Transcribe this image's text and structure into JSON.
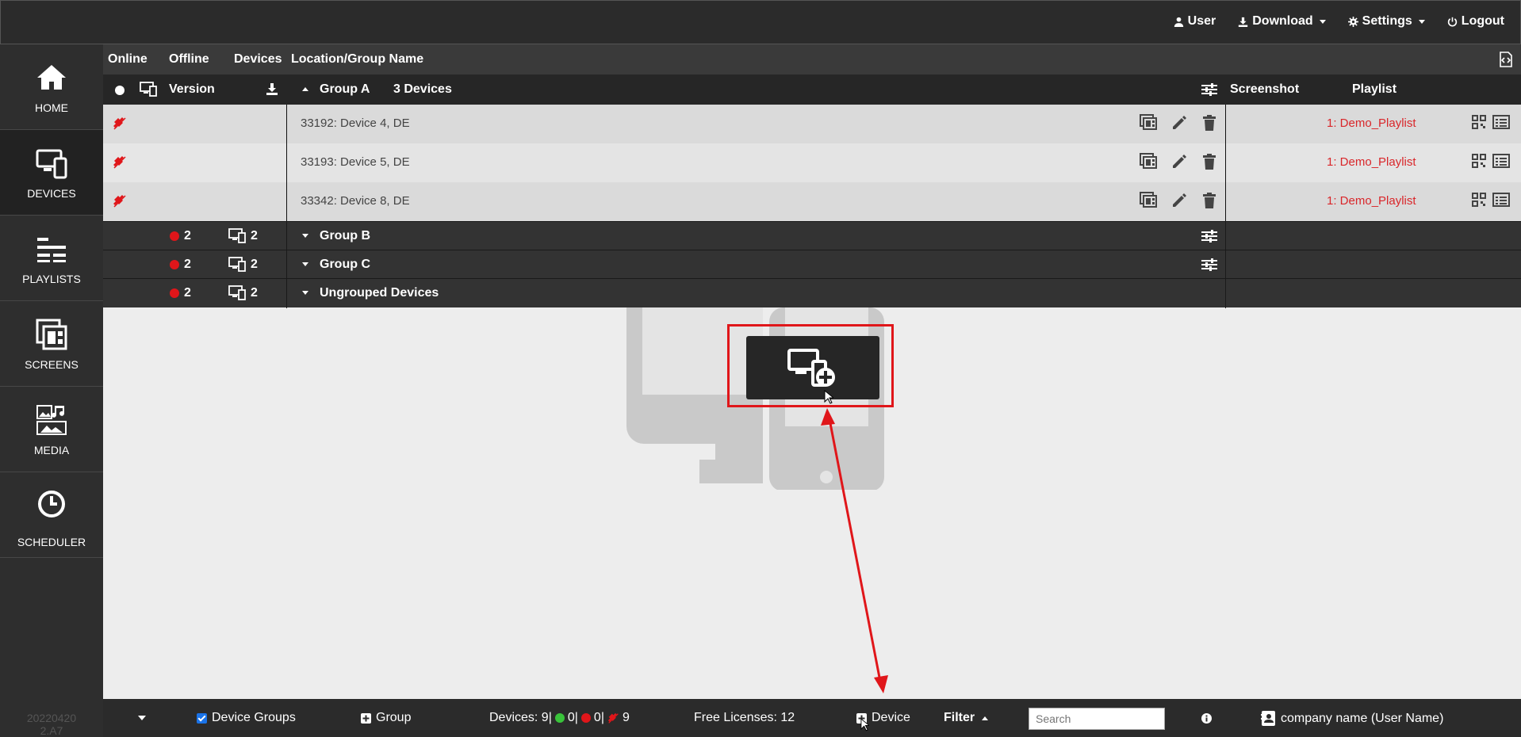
{
  "topmenu": {
    "user": "User",
    "download": "Download",
    "settings": "Settings",
    "logout": "Logout"
  },
  "sidebar": {
    "items": [
      {
        "label": "HOME",
        "icon": "home-icon"
      },
      {
        "label": "DEVICES",
        "icon": "devices-icon",
        "active": true
      },
      {
        "label": "PLAYLISTS",
        "icon": "playlists-icon"
      },
      {
        "label": "SCREENS",
        "icon": "screens-icon"
      },
      {
        "label": "MEDIA",
        "icon": "media-icon"
      },
      {
        "label": "SCHEDULER",
        "icon": "clock-icon"
      }
    ],
    "version": "20220420\n2.A7"
  },
  "header": {
    "online": "Online",
    "offline": "Offline",
    "devices": "Devices",
    "location": "Location/Group Name",
    "version": "Version",
    "group_a": "Group A",
    "group_a_count": "3 Devices",
    "screenshot": "Screenshot",
    "playlist": "Playlist"
  },
  "devices": [
    {
      "name": "33192: Device 4, DE",
      "playlist": "1: Demo_Playlist"
    },
    {
      "name": "33193: Device 5, DE",
      "playlist": "1: Demo_Playlist"
    },
    {
      "name": "33342: Device 8, DE",
      "playlist": "1: Demo_Playlist"
    }
  ],
  "groups": [
    {
      "offline": "2",
      "devices": "2",
      "name": "Group B"
    },
    {
      "offline": "2",
      "devices": "2",
      "name": "Group C"
    },
    {
      "offline": "2",
      "devices": "2",
      "name": "Ungrouped Devices"
    }
  ],
  "footer": {
    "device_groups": "Device Groups",
    "group": "Group",
    "devices_prefix": "Devices: 9|",
    "online_count": "0|",
    "offline_count": "0|",
    "unplugged_count": "9",
    "free_licenses": "Free Licenses: 12",
    "device": "Device",
    "filter": "Filter",
    "search_placeholder": "Search",
    "account": "company name (User Name)"
  },
  "colors": {
    "accent_red": "#e0161a",
    "online_green": "#39c33a",
    "sidebar_bg": "#2e2e2e"
  }
}
